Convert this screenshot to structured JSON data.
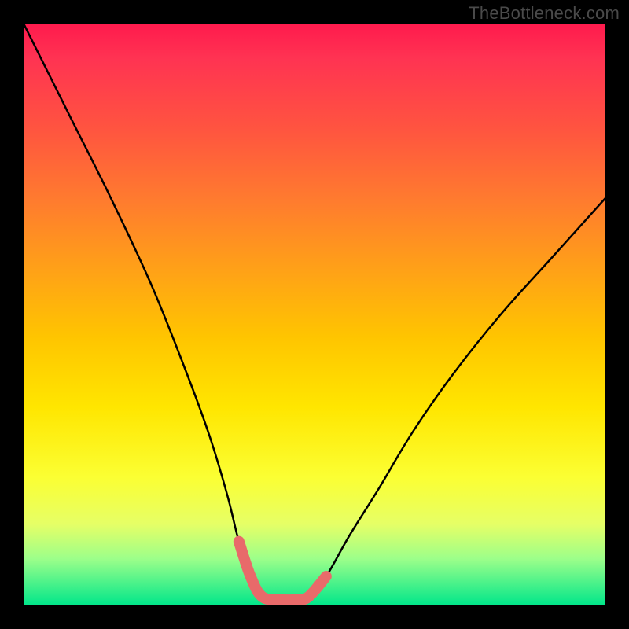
{
  "watermark": "TheBottleneck.com",
  "chart_data": {
    "type": "line",
    "title": "",
    "xlabel": "",
    "ylabel": "",
    "xlim": [
      0,
      100
    ],
    "ylim": [
      0,
      100
    ],
    "series": [
      {
        "name": "bottleneck-curve",
        "x": [
          0,
          8,
          15,
          22,
          28,
          32,
          35,
          37,
          39,
          41,
          44,
          47,
          49,
          52,
          56,
          61,
          67,
          74,
          82,
          91,
          100
        ],
        "values": [
          100,
          84,
          70,
          55,
          40,
          29,
          19,
          11,
          5,
          1.5,
          1,
          1,
          1.5,
          5,
          12,
          20,
          30,
          40,
          50,
          60,
          70
        ]
      },
      {
        "name": "highlight-segment",
        "x": [
          37,
          39,
          41,
          44,
          47,
          49,
          52
        ],
        "values": [
          11,
          5,
          1.5,
          1,
          1,
          1.5,
          5
        ]
      }
    ],
    "colors": {
      "curve": "#000000",
      "highlight": "#e86a6a"
    }
  }
}
